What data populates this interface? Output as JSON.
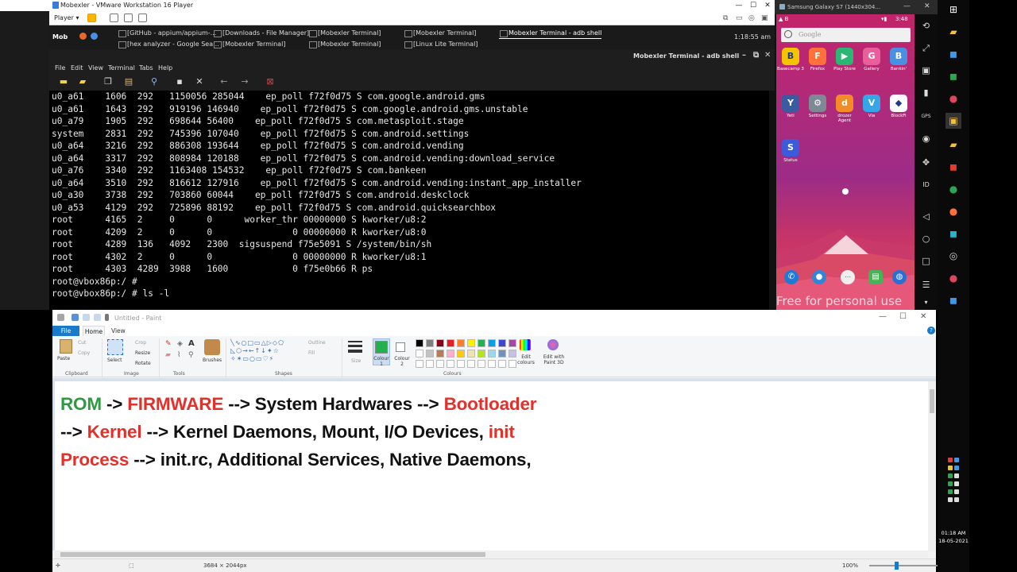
{
  "vmware": {
    "title": "Mobexler - VMware Workstation 16 Player",
    "player_menu": "Player ▾",
    "window_controls": [
      "—",
      "☐",
      "✕"
    ]
  },
  "guest_taskbar": {
    "launcher": "Mob",
    "clock": "1:18:55 am",
    "tasks_row1": [
      {
        "label": "[GitHub - appium/appium-...",
        "active": false
      },
      {
        "label": "[Downloads - File Manager]",
        "active": false
      },
      {
        "label": "[Mobexler Terminal]",
        "active": false
      },
      {
        "label": "[Mobexler Terminal]",
        "active": false
      },
      {
        "label": "Mobexler Terminal - adb shell",
        "active": true
      }
    ],
    "tasks_row2": [
      {
        "label": "[hex analyzer - Google Sea..."
      },
      {
        "label": "[Mobexler Terminal]"
      },
      {
        "label": "[Mobexler Terminal]"
      },
      {
        "label": "[Linux Lite Terminal]"
      }
    ]
  },
  "terminal": {
    "title": "Mobexler Terminal - adb shell",
    "menu": [
      "File",
      "Edit",
      "View",
      "Terminal",
      "Tabs",
      "Help"
    ],
    "lines": [
      "u0_a61    1606  292   1150056 285044    ep_poll f72f0d75 S com.google.android.gms",
      "u0_a61    1643  292   919196 146940    ep_poll f72f0d75 S com.google.android.gms.unstable",
      "u0_a79    1905  292   698644 56400    ep_poll f72f0d75 S com.metasploit.stage",
      "system    2831  292   745396 107040    ep_poll f72f0d75 S com.android.settings",
      "u0_a64    3216  292   886308 193644    ep_poll f72f0d75 S com.android.vending",
      "u0_a64    3317  292   808984 120188    ep_poll f72f0d75 S com.android.vending:download_service",
      "u0_a76    3340  292   1163408 154532    ep_poll f72f0d75 S com.bankeen",
      "u0_a64    3510  292   816612 127916    ep_poll f72f0d75 S com.android.vending:instant_app_installer",
      "u0_a30    3738  292   703860 60044    ep_poll f72f0d75 S com.android.deskclock",
      "u0_a53    4129  292   725896 88192    ep_poll f72f0d75 S com.android.quicksearchbox",
      "root      4165  2     0      0      worker_thr 00000000 S kworker/u8:2",
      "root      4209  2     0      0               0 00000000 R kworker/u8:0",
      "root      4289  136   4092   2300  sigsuspend f75e5091 S /system/bin/sh",
      "root      4302  2     0      0               0 00000000 R kworker/u8:1",
      "root      4303  4289  3988   1600            0 f75e0b66 R ps",
      "root@vbox86p:/ #",
      "root@vbox86p:/ # ls -l"
    ]
  },
  "emulator": {
    "title": "Samsung Galaxy S7 (1440x304...",
    "status_time": "3:48",
    "search_placeholder": "Google",
    "apps_row1": [
      {
        "label": "Basecamp 3",
        "icon": "B",
        "color": "#f5c400"
      },
      {
        "label": "Firefox",
        "icon": "F",
        "color": "#ff7139"
      },
      {
        "label": "Play Store",
        "icon": "▶",
        "color": "#2bb673"
      },
      {
        "label": "Gallery",
        "icon": "G",
        "color": "#e85f9b"
      },
      {
        "label": "Bankin'",
        "icon": "B",
        "color": "#4a90e2"
      }
    ],
    "apps_row2": [
      {
        "label": "Yeti",
        "icon": "Y",
        "color": "#3a5ba0"
      },
      {
        "label": "Settings",
        "icon": "⚙",
        "color": "#7d8a96"
      },
      {
        "label": "drozer Agent",
        "icon": "d",
        "color": "#f28c28"
      },
      {
        "label": "Via",
        "icon": "V",
        "color": "#35a6e8"
      },
      {
        "label": "BlockFi",
        "icon": "◆",
        "color": "#ffffff"
      }
    ],
    "apps_row3": [
      {
        "label": "Status",
        "icon": "S",
        "color": "#3b5bdb"
      }
    ],
    "watermark": "Free for personal use"
  },
  "paint": {
    "title": "Untitled - Paint",
    "tabs": {
      "file": "File",
      "home": "Home",
      "view": "View"
    },
    "ribbon": {
      "paste": "Paste",
      "cut": "Cut",
      "copy": "Copy",
      "select": "Select",
      "crop": "Crop",
      "resize": "Resize",
      "rotate": "Rotate",
      "brushes": "Brushes",
      "outline": "Outline",
      "fill": "Fill",
      "size": "Size",
      "colour1": "Colour 1",
      "colour2": "Colour 2",
      "edit_colours": "Edit colours",
      "edit_paint3d": "Edit with Paint 3D",
      "groups": {
        "clipboard": "Clipboard",
        "image": "Image",
        "tools": "Tools",
        "shapes": "Shapes",
        "colours": "Colours"
      },
      "palette_row1": [
        "#000000",
        "#7f7f7f",
        "#880015",
        "#ed1c24",
        "#ff7f27",
        "#fff200",
        "#22b14c",
        "#00a2e8",
        "#3f48cc",
        "#a349a4"
      ],
      "palette_row2": [
        "#ffffff",
        "#c3c3c3",
        "#b97a57",
        "#ffaec9",
        "#ffc90e",
        "#efe4b0",
        "#b5e61d",
        "#99d9ea",
        "#7092be",
        "#c8bfe7"
      ],
      "colour1_value": "#22b14c"
    },
    "canvas_text": {
      "l1": [
        {
          "t": "ROM",
          "c": "grn"
        },
        {
          "t": " -> ",
          "c": ""
        },
        {
          "t": "FIRMWARE",
          "c": "red"
        },
        {
          "t": " --> System Hardwares --> ",
          "c": ""
        },
        {
          "t": "Bootloader",
          "c": "red"
        }
      ],
      "l2": [
        {
          "t": "--> ",
          "c": ""
        },
        {
          "t": "Kernel",
          "c": "red"
        },
        {
          "t": " --> Kernel Daemons, Mount, I/O Devices, ",
          "c": ""
        },
        {
          "t": "init",
          "c": "red"
        }
      ],
      "l3": [
        {
          "t": "Process",
          "c": "red"
        },
        {
          "t": " --> init.rc, Additional Services, Native Daemons,",
          "c": ""
        }
      ]
    },
    "status": {
      "dimensions": "3684 × 2044px",
      "zoom": "100%"
    }
  },
  "windows": {
    "clock_time": "01:18 AM",
    "clock_date": "18-05-2021"
  }
}
